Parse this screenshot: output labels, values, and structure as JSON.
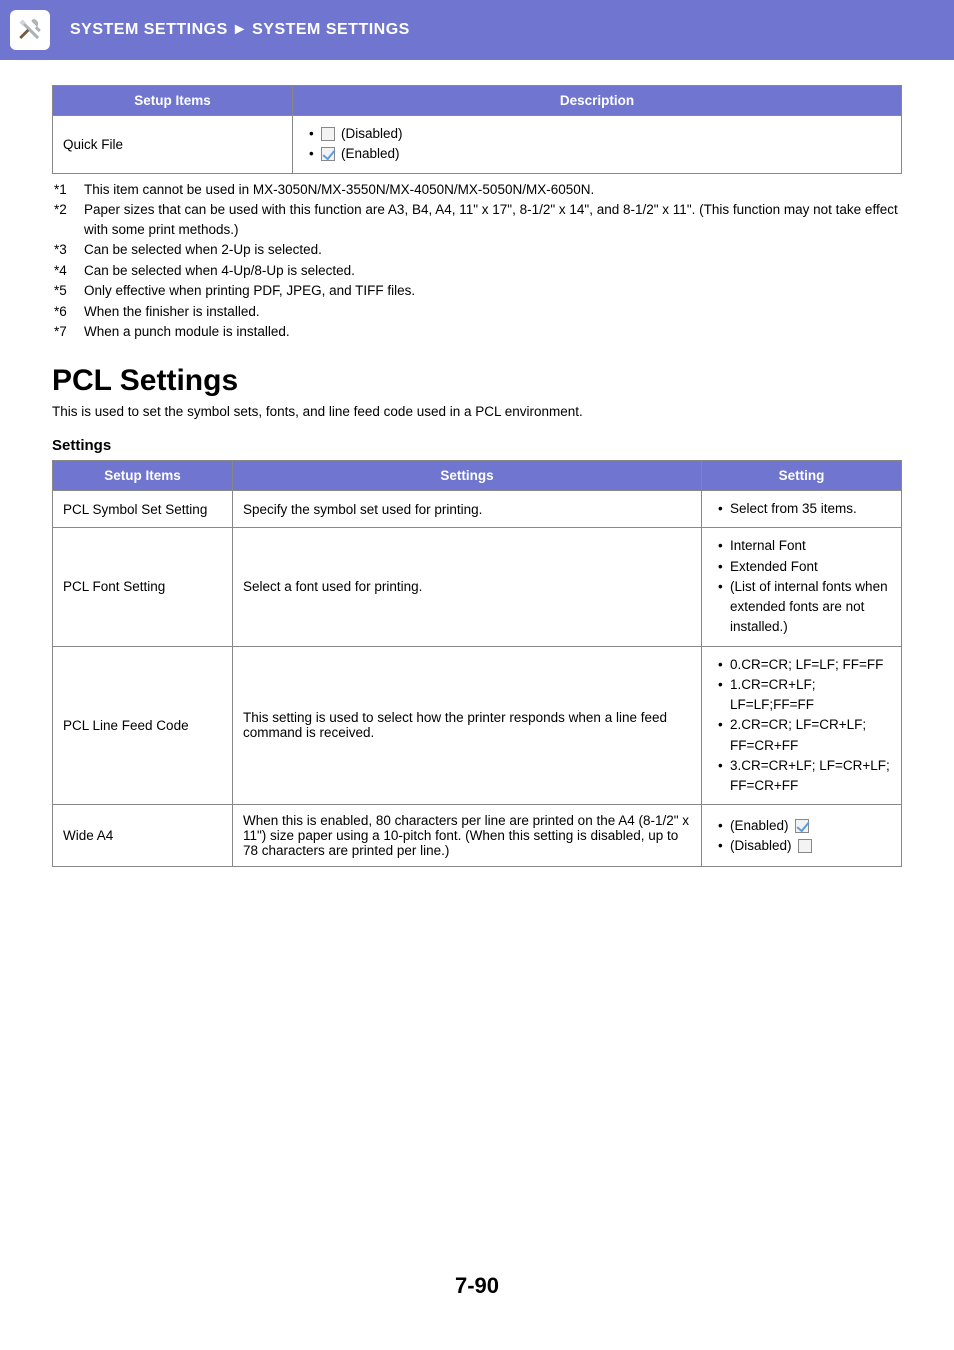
{
  "header": {
    "breadcrumb_1": "SYSTEM SETTINGS",
    "breadcrumb_2": "SYSTEM SETTINGS"
  },
  "table1": {
    "col1": "Setup Items",
    "col2": "Description",
    "row1_item": "Quick File",
    "row1_opt1": "(Disabled)",
    "row1_opt2": "(Enabled)"
  },
  "footnotes": {
    "m1": "*1",
    "t1": "This item cannot be used in MX-3050N/MX-3550N/MX-4050N/MX-5050N/MX-6050N.",
    "m2": "*2",
    "t2": "Paper sizes that can be used with this function are A3, B4, A4, 11\" x 17\", 8-1/2\" x 14\", and 8-1/2\" x 11\". (This function may not take effect with some print methods.)",
    "m3": "*3",
    "t3": "Can be selected when 2-Up is selected.",
    "m4": "*4",
    "t4": "Can be selected when 4-Up/8-Up is selected.",
    "m5": "*5",
    "t5": "Only effective when printing PDF, JPEG, and TIFF files.",
    "m6": "*6",
    "t6": "When the finisher is installed.",
    "m7": "*7",
    "t7": "When a punch module is installed."
  },
  "pcl": {
    "title": "PCL Settings",
    "intro": "This is used to set the symbol sets, fonts, and line feed code used in a PCL environment.",
    "sub": "Settings",
    "col1": "Setup Items",
    "col2": "Settings",
    "col3": "Setting",
    "r1_item": "PCL Symbol Set Setting",
    "r1_desc": "Specify the symbol set used for printing.",
    "r1_set1": "Select from 35 items.",
    "r2_item": "PCL Font Setting",
    "r2_desc": "Select a font used for printing.",
    "r2_set1": "Internal Font",
    "r2_set2": "Extended Font",
    "r2_set3": "(List of internal fonts when extended fonts are not installed.)",
    "r3_item": "PCL Line Feed Code",
    "r3_desc": "This setting is used to select how the printer responds when a line feed command is received.",
    "r3_set1": "0.CR=CR; LF=LF; FF=FF",
    "r3_set2": "1.CR=CR+LF; LF=LF;FF=FF",
    "r3_set3": "2.CR=CR; LF=CR+LF; FF=CR+FF",
    "r3_set4": "3.CR=CR+LF; LF=CR+LF; FF=CR+FF",
    "r4_item": "Wide A4",
    "r4_desc": "When this is enabled, 80 characters per line are printed on the A4 (8-1/2\" x 11\") size paper using a 10-pitch font. (When this setting is disabled, up to 78 characters are printed per line.)",
    "r4_set1": "(Enabled)",
    "r4_set2": "(Disabled)"
  },
  "page_number": "7-90"
}
